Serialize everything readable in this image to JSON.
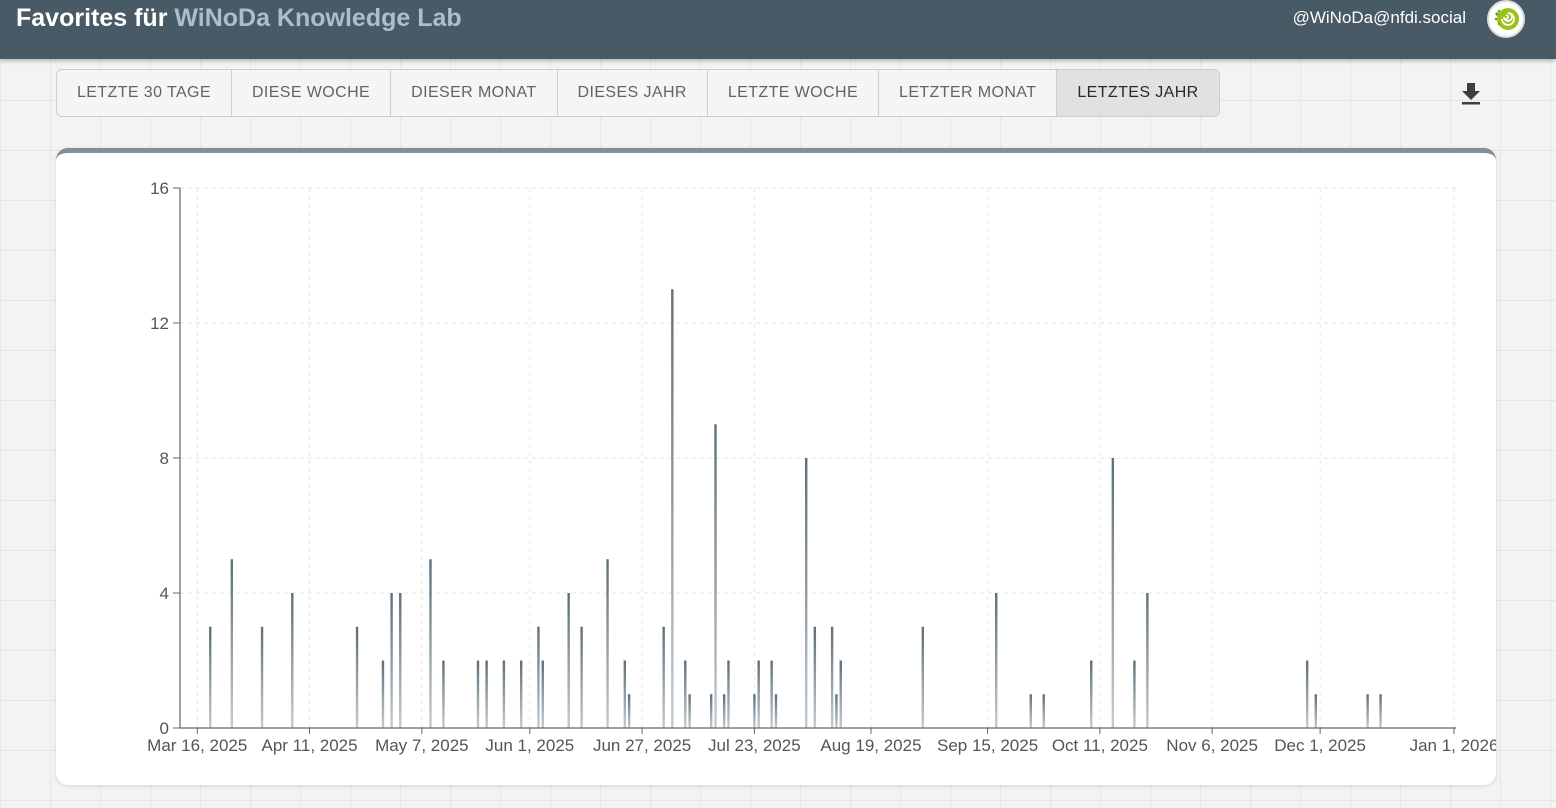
{
  "header": {
    "title_prefix": "Favorites für ",
    "title_name": "WiNoDa Knowledge Lab",
    "handle": "@WiNoDa@nfdi.social",
    "colors": {
      "bar": "#485a66",
      "accent": "#a9bfcb"
    }
  },
  "tabs": [
    {
      "label": "LETZTE 30 TAGE",
      "active": false
    },
    {
      "label": "DIESE WOCHE",
      "active": false
    },
    {
      "label": "DIESER MONAT",
      "active": false
    },
    {
      "label": "DIESES JAHR",
      "active": false
    },
    {
      "label": "LETZTE WOCHE",
      "active": false
    },
    {
      "label": "LETZTER MONAT",
      "active": false
    },
    {
      "label": "LETZTES JAHR",
      "active": true
    }
  ],
  "toolbar": {
    "download_icon": "download-icon"
  },
  "chart_data": {
    "type": "bar",
    "title": "",
    "xlabel": "",
    "ylabel": "",
    "ylim": [
      0,
      16
    ],
    "xlim": [
      "2025-03-12",
      "2026-01-01"
    ],
    "yticks": [
      0,
      4,
      8,
      12,
      16
    ],
    "xticks": [
      {
        "date": "2025-03-16",
        "label": "Mar 16, 2025"
      },
      {
        "date": "2025-04-11",
        "label": "Apr 11, 2025"
      },
      {
        "date": "2025-05-07",
        "label": "May 7, 2025"
      },
      {
        "date": "2025-06-01",
        "label": "Jun 1, 2025"
      },
      {
        "date": "2025-06-27",
        "label": "Jun 27, 2025"
      },
      {
        "date": "2025-07-23",
        "label": "Jul 23, 2025"
      },
      {
        "date": "2025-08-19",
        "label": "Aug 19, 2025"
      },
      {
        "date": "2025-09-15",
        "label": "Sep 15, 2025"
      },
      {
        "date": "2025-10-11",
        "label": "Oct 11, 2025"
      },
      {
        "date": "2025-11-06",
        "label": "Nov 6, 2025"
      },
      {
        "date": "2025-12-01",
        "label": "Dec 1, 2025"
      },
      {
        "date": "2026-01-01",
        "label": "Jan 1, 2026"
      }
    ],
    "grid": true,
    "color": "#6e7f89",
    "x": [
      "2025-03-19",
      "2025-03-24",
      "2025-03-31",
      "2025-04-07",
      "2025-04-22",
      "2025-04-28",
      "2025-04-30",
      "2025-05-02",
      "2025-05-09",
      "2025-05-12",
      "2025-05-20",
      "2025-05-22",
      "2025-05-26",
      "2025-05-30",
      "2025-06-03",
      "2025-06-04",
      "2025-06-10",
      "2025-06-13",
      "2025-06-19",
      "2025-06-23",
      "2025-06-24",
      "2025-07-02",
      "2025-07-04",
      "2025-07-07",
      "2025-07-08",
      "2025-07-13",
      "2025-07-14",
      "2025-07-16",
      "2025-07-17",
      "2025-07-23",
      "2025-07-24",
      "2025-07-27",
      "2025-07-28",
      "2025-08-04",
      "2025-08-06",
      "2025-08-10",
      "2025-08-11",
      "2025-08-12",
      "2025-08-31",
      "2025-09-17",
      "2025-09-25",
      "2025-09-28",
      "2025-10-09",
      "2025-10-14",
      "2025-10-19",
      "2025-10-22",
      "2025-11-28",
      "2025-11-30",
      "2025-12-12",
      "2025-12-15"
    ],
    "values": [
      3,
      5,
      3,
      4,
      3,
      2,
      4,
      4,
      5,
      2,
      2,
      2,
      2,
      2,
      3,
      2,
      4,
      3,
      5,
      2,
      1,
      3,
      13,
      2,
      1,
      1,
      9,
      1,
      2,
      1,
      2,
      2,
      1,
      8,
      3,
      3,
      1,
      2,
      3,
      4,
      1,
      1,
      2,
      8,
      2,
      4,
      2,
      1,
      1,
      1
    ]
  }
}
